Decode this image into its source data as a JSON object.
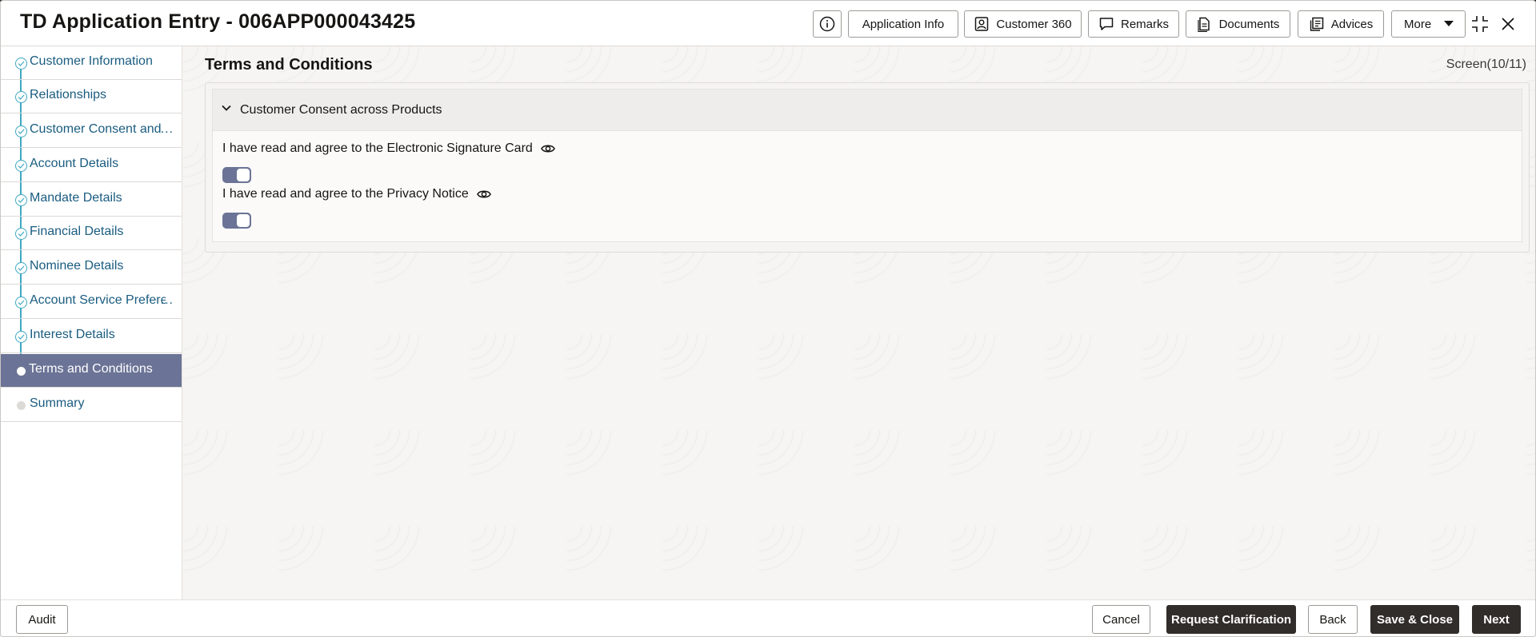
{
  "header": {
    "title": "TD Application Entry - 006APP000043425",
    "buttons": {
      "application_info": "Application Info",
      "customer_360": "Customer 360",
      "remarks": "Remarks",
      "documents": "Documents",
      "advices": "Advices",
      "more": "More"
    }
  },
  "sidebar": {
    "items": [
      {
        "label": "Customer Information",
        "state": "done"
      },
      {
        "label": "Relationships",
        "state": "done"
      },
      {
        "label": "Customer Consent and",
        "state": "done",
        "truncated": "..."
      },
      {
        "label": "Account Details",
        "state": "done"
      },
      {
        "label": "Mandate Details",
        "state": "done"
      },
      {
        "label": "Financial Details",
        "state": "done"
      },
      {
        "label": "Nominee Details",
        "state": "done"
      },
      {
        "label": "Account Service Prefere",
        "state": "done",
        "truncated": "..."
      },
      {
        "label": "Interest Details",
        "state": "done"
      },
      {
        "label": "Terms and Conditions",
        "state": "current"
      },
      {
        "label": "Summary",
        "state": "pending"
      }
    ]
  },
  "main": {
    "title": "Terms and Conditions",
    "screen": "Screen(10/11)",
    "section": {
      "title": "Customer Consent across Products",
      "consents": [
        {
          "label": "I have read and agree to the Electronic Signature Card",
          "checked": true
        },
        {
          "label": "I have read and agree to the Privacy Notice",
          "checked": true
        }
      ]
    }
  },
  "footer": {
    "audit": "Audit",
    "cancel": "Cancel",
    "request_clarification": "Request Clarification",
    "back": "Back",
    "save_close": "Save & Close",
    "next": "Next"
  },
  "colors": {
    "accent": "#6b7496",
    "nav_text": "#1a5c80",
    "rail": "#3fa8c2",
    "dark_button": "#312d2a"
  }
}
